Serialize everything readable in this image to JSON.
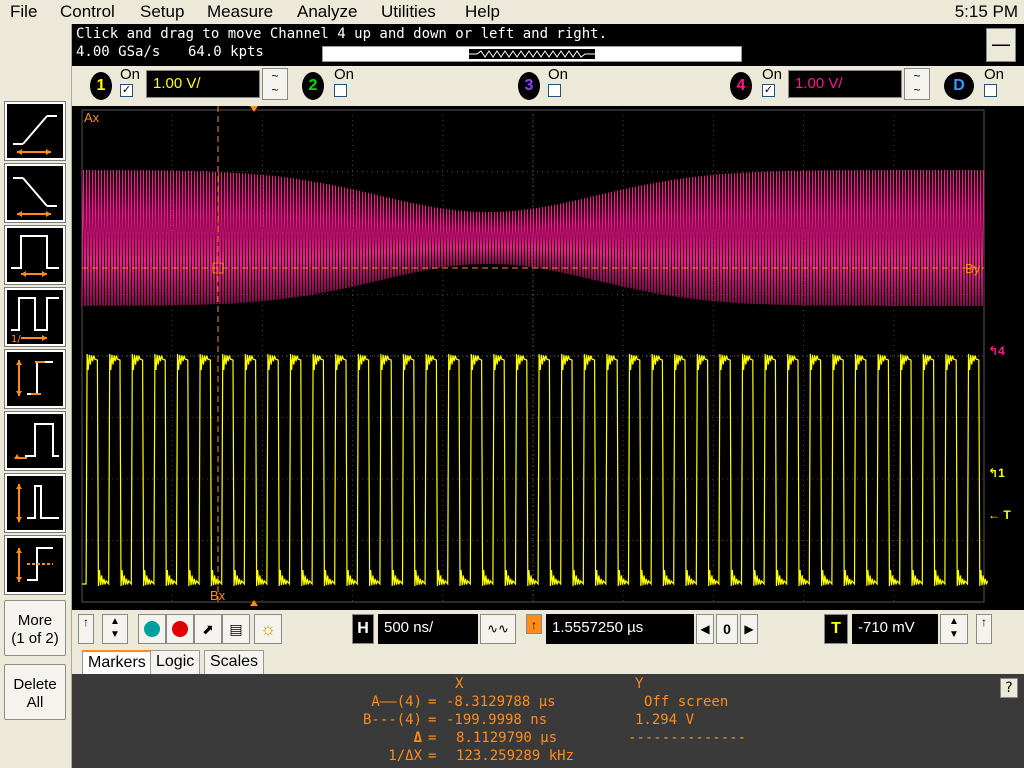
{
  "menu": [
    "File",
    "Control",
    "Setup",
    "Measure",
    "Analyze",
    "Utilities",
    "Help"
  ],
  "clock": "5:15 PM",
  "status": {
    "message": "Click and drag to move Channel 4 up and down or left and right.",
    "sample_rate": "4.00 GSa/s",
    "memory": "64.0 kpts",
    "minimize": "—"
  },
  "channels": [
    {
      "num": "1",
      "on_label": "On",
      "checked": true,
      "scale": "1.00 V/",
      "color": "#ffff00"
    },
    {
      "num": "2",
      "on_label": "On",
      "checked": false,
      "color": "#00e000"
    },
    {
      "num": "3",
      "on_label": "On",
      "checked": false,
      "color": "#8844ff"
    },
    {
      "num": "4",
      "on_label": "On",
      "checked": true,
      "scale": "1.00 V/",
      "color": "#ff1493"
    },
    {
      "num": "D",
      "on_label": "On",
      "checked": false,
      "color": "#3399ff"
    }
  ],
  "screen": {
    "marker_ax": "Ax",
    "marker_bx": "Bx",
    "marker_by": "By",
    "ch4_marker": "4",
    "ch1_marker": "1",
    "trigger_marker": "T"
  },
  "left": {
    "more_label": "More",
    "more_page": "(1 of 2)",
    "delete_label": "Delete",
    "delete_all": "All"
  },
  "horizontal": {
    "h_label": "H",
    "timebase": "500 ns/",
    "position": "1.5557250 µs",
    "zero": "0",
    "t_label": "T",
    "trigger_level": "-710 mV"
  },
  "tabs": [
    "Markers",
    "Logic",
    "Scales"
  ],
  "markers": {
    "x_header": "X",
    "y_header": "Y",
    "rows": [
      {
        "label": "A——(4)",
        "eq": "=",
        "x": "-8.3129788 µs",
        "y": "Off screen"
      },
      {
        "label": "B---(4)",
        "eq": "=",
        "x": "-199.9998 ns",
        "y": "1.294 V"
      },
      {
        "label": "Δ",
        "eq": "=",
        "x": "8.1129790 µs",
        "y": "--------------"
      },
      {
        "label": "1/ΔX",
        "eq": "=",
        "x": "123.259289 kHz",
        "y": ""
      }
    ],
    "help": "?"
  },
  "colors": {
    "ch1": "#ffff00",
    "ch4": "#ff1493",
    "marker": "#ff8c1a"
  }
}
